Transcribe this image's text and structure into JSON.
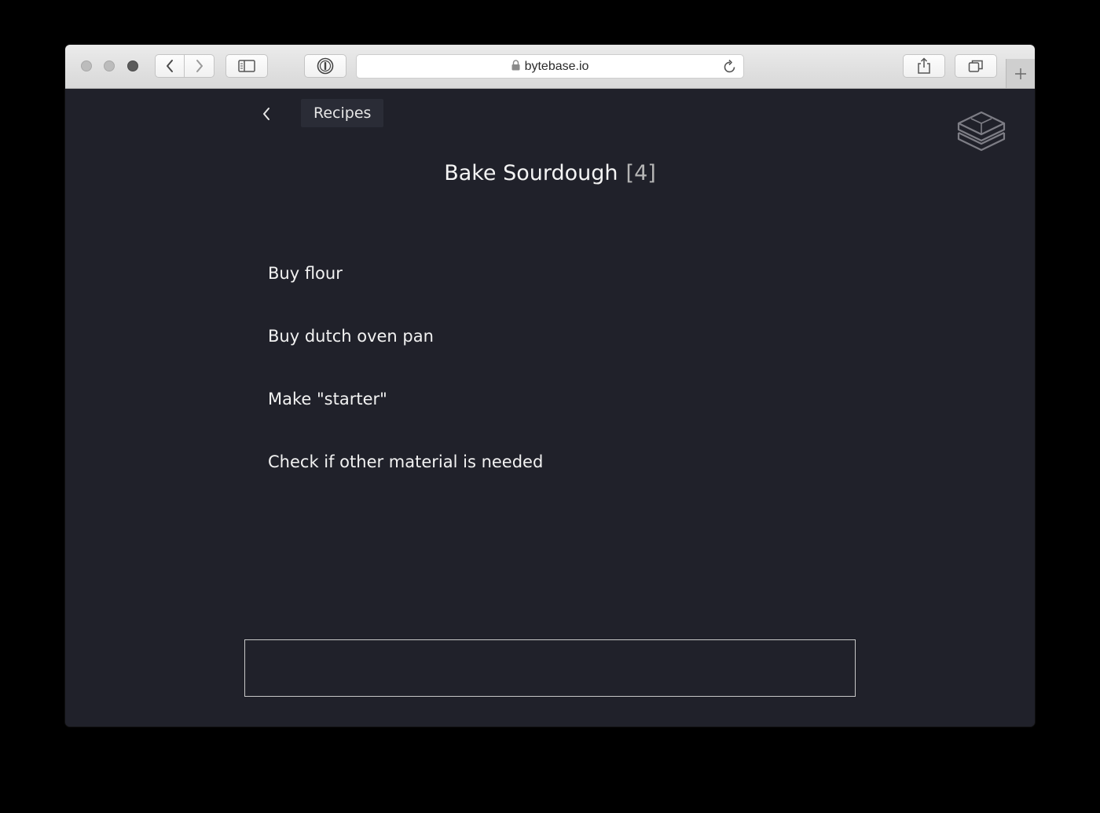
{
  "browser": {
    "url": "bytebase.io",
    "icons": {
      "back": "chevron-left-icon",
      "forward": "chevron-right-icon",
      "sidebar": "sidebar-icon",
      "password": "password-manager-icon",
      "lock": "lock-icon",
      "reload": "reload-icon",
      "share": "share-icon",
      "tabs": "tabs-overview-icon",
      "new_tab": "plus-icon"
    }
  },
  "header": {
    "back_icon": "chevron-left-icon",
    "breadcrumb": "Recipes",
    "logo_icon": "stacked-cube-logo-icon"
  },
  "project": {
    "title": "Bake Sourdough",
    "count": "[4]"
  },
  "tasks": [
    {
      "label": "Buy flour"
    },
    {
      "label": "Buy dutch oven pan"
    },
    {
      "label": "Make \"starter\""
    },
    {
      "label": "Check if other material is needed"
    }
  ],
  "new_task": {
    "value": "",
    "placeholder": ""
  },
  "colors": {
    "page_background": "#20212a",
    "text": "#f2f2f2",
    "count_text": "#b5b5b5",
    "breadcrumb_background": "#2a2c36"
  }
}
